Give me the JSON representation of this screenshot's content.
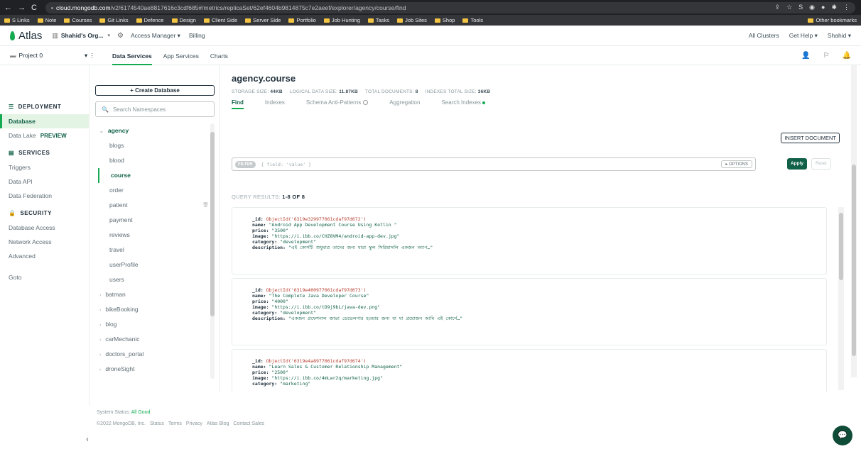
{
  "browser": {
    "url_domain": "cloud.mongodb.com",
    "url_path": "/v2/6174540ae8817616c3cdf685#/metrics/replicaSet/62ef4604b9814875c7e2aeef/explorer/agency/course/find",
    "bookmarks": [
      "S Links",
      "Note",
      "Courses",
      "Git Links",
      "Defence",
      "Design",
      "Client Side",
      "Server Side",
      "Portfolio",
      "Job Hunting",
      "Tasks",
      "Job Sites",
      "Shop",
      "Tools"
    ],
    "other_bookmarks": "Other bookmarks"
  },
  "header": {
    "logo": "Atlas",
    "org": "Shahid's Org...",
    "access_manager": "Access Manager ▾",
    "billing": "Billing",
    "all_clusters": "All Clusters",
    "get_help": "Get Help ▾",
    "user": "Shahid ▾",
    "project": "Project 0",
    "tabs": [
      "Data Services",
      "App Services",
      "Charts"
    ]
  },
  "leftnav": {
    "deployment": "DEPLOYMENT",
    "database": "Database",
    "data_lake": "Data Lake",
    "preview": "PREVIEW",
    "services": "SERVICES",
    "triggers": "Triggers",
    "data_api": "Data API",
    "data_federation": "Data Federation",
    "security": "SECURITY",
    "database_access": "Database Access",
    "network_access": "Network Access",
    "advanced": "Advanced",
    "goto": "Goto"
  },
  "dbpanel": {
    "create_database": "+ Create Database",
    "search_placeholder": "Search Namespaces",
    "databases": [
      {
        "name": "agency",
        "open": true,
        "collections": [
          "blogs",
          "blood",
          "course",
          "order",
          "patient",
          "payment",
          "reviews",
          "travel",
          "userProfile",
          "users"
        ]
      },
      {
        "name": "batman"
      },
      {
        "name": "bikeBooking"
      },
      {
        "name": "blog"
      },
      {
        "name": "carMechanic"
      },
      {
        "name": "doctors_portal"
      },
      {
        "name": "droneSight"
      }
    ]
  },
  "main": {
    "title": "agency.course",
    "storage_label": "STORAGE SIZE:",
    "storage_value": "44KB",
    "logical_label": "LOGICAL DATA SIZE:",
    "logical_value": "11.87KB",
    "total_docs_label": "TOTAL DOCUMENTS:",
    "total_docs_value": "8",
    "index_label": "INDEXES TOTAL SIZE:",
    "index_value": "36KB",
    "subtabs": [
      "Find",
      "Indexes",
      "Schema Anti-Patterns",
      "Aggregation",
      "Search Indexes"
    ],
    "insert_document": "INSERT DOCUMENT",
    "filter_tag": "FILTER",
    "filter_placeholder": "{ field: 'value' }",
    "options": "▸ OPTIONS",
    "apply": "Apply",
    "reset": "Reset",
    "query_results_label": "QUERY RESULTS:",
    "query_results_value": "1-8 OF 8"
  },
  "documents": [
    {
      "id": "ObjectId('6319e329977061cdaf97d672')",
      "name": "\"Android App Development Course Using Kotlin \"",
      "price": "\"3500\"",
      "image": "\"https://i.ibb.co/CHZ8VM4/android-app-dev.jpg\"",
      "category": "\"development\"",
      "description": "\"এই কোর্সটি শুধুমাত্র তাদের জন্য যারা স্কুল সিরিয়াসলি একজন অ্যাপ…\""
    },
    {
      "id": "ObjectId('6319e400977061cdaf97d673')",
      "name": "\"The Complete Java Developer Course\"",
      "price": "\"4000\"",
      "image": "\"https://i.ibb.co/tD9j9bL/java-dev.png\"",
      "category": "\"development\"",
      "description": "\"একজন প্রফেশনাল জাভা ডেভেলপার হওয়ার জন্য যা যা প্রয়োজন আমি এই কোর্সে…\""
    },
    {
      "id": "ObjectId('6319e4a8977061cdaf97d674')",
      "name": "\"Learn Sales & Customer Relationship Management\"",
      "price": "\"2500\"",
      "image": "\"https://i.ibb.co/4mLwr2q/marketing.jpg\"",
      "category": "\"marketing\"",
      "description": ""
    }
  ],
  "footer": {
    "system_status_label": "System Status:",
    "system_status_value": "All Good",
    "copyright": "©2022 MongoDB, Inc.",
    "links": [
      "Status",
      "Terms",
      "Privacy",
      "Atlas Blog",
      "Contact Sales"
    ]
  }
}
